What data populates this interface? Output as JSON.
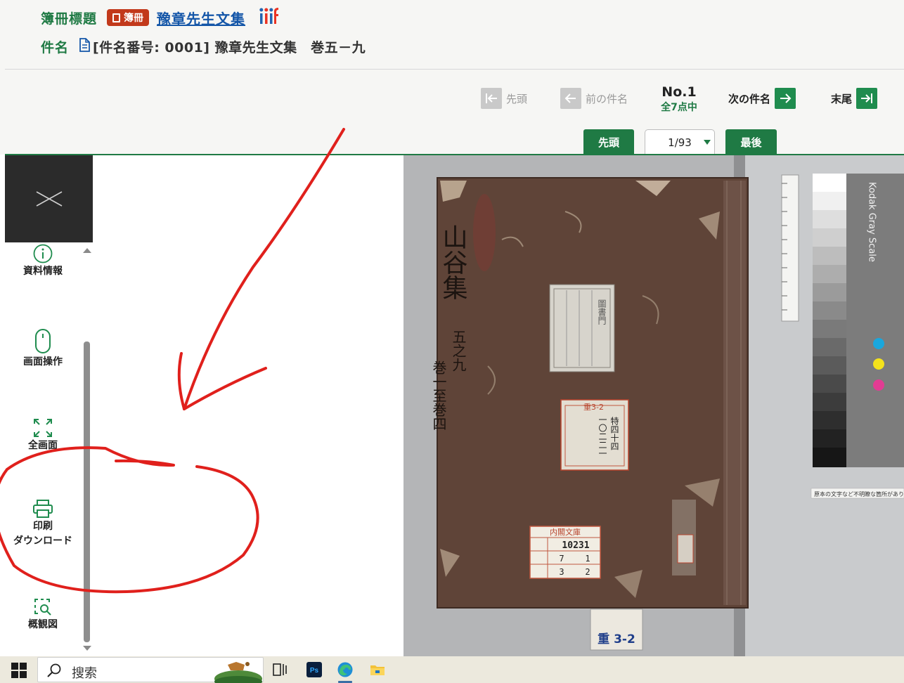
{
  "header": {
    "title_label": "簿冊標題",
    "badge_label": "簿冊",
    "book_title_link": "豫章先生文集",
    "iiif_label": "iiif",
    "item_label": "件名",
    "item_text": "[件名番号: 0001] 豫章先生文集　巻五－九"
  },
  "navigation": {
    "first_label": "先頭",
    "prev_label": "前の件名",
    "no_number": "No.1",
    "no_total": "全7点中",
    "next_label": "次の件名",
    "last_label": "末尾"
  },
  "pager": {
    "first_tab": "先頭",
    "page_value": "1/93",
    "last_tab": "最後"
  },
  "sidebar": {
    "items": [
      {
        "label": "資料情報",
        "icon": "info-icon"
      },
      {
        "label": "画面操作",
        "icon": "mouse-icon"
      },
      {
        "label": "全画面",
        "icon": "fullscreen-icon"
      },
      {
        "label_line1": "印刷",
        "label_line2": "ダウンロード",
        "icon": "printer-icon"
      },
      {
        "label": "概観図",
        "icon": "overview-icon"
      }
    ]
  },
  "scan": {
    "cover_title": "山谷集",
    "cover_subtitle_1": "五之九",
    "cover_subtitle_2": "巻一至巻四",
    "label_top": "圖書門",
    "label_mid_1": "特四十四",
    "label_mid_2": "一〇二二一",
    "label_mid_3": "重3-2",
    "library_label_title": "内閣文庫",
    "library_label_no": "10231",
    "library_label_row2a": "7",
    "library_label_row2b": "1",
    "library_label_row3a": "3",
    "library_label_row3b": "2",
    "spine_tag": "重 3-2",
    "kodak_text": "Kodak Gray Scale",
    "notice_strip": "原本の文字など不明瞭な箇所があります"
  },
  "taskbar": {
    "search_placeholder": "搜索",
    "ps_label": "Ps"
  },
  "colors": {
    "brand_green": "#1f7a44",
    "badge_red": "#c2391b",
    "link_blue": "#1456a8",
    "annotation_red": "#e0201c"
  }
}
